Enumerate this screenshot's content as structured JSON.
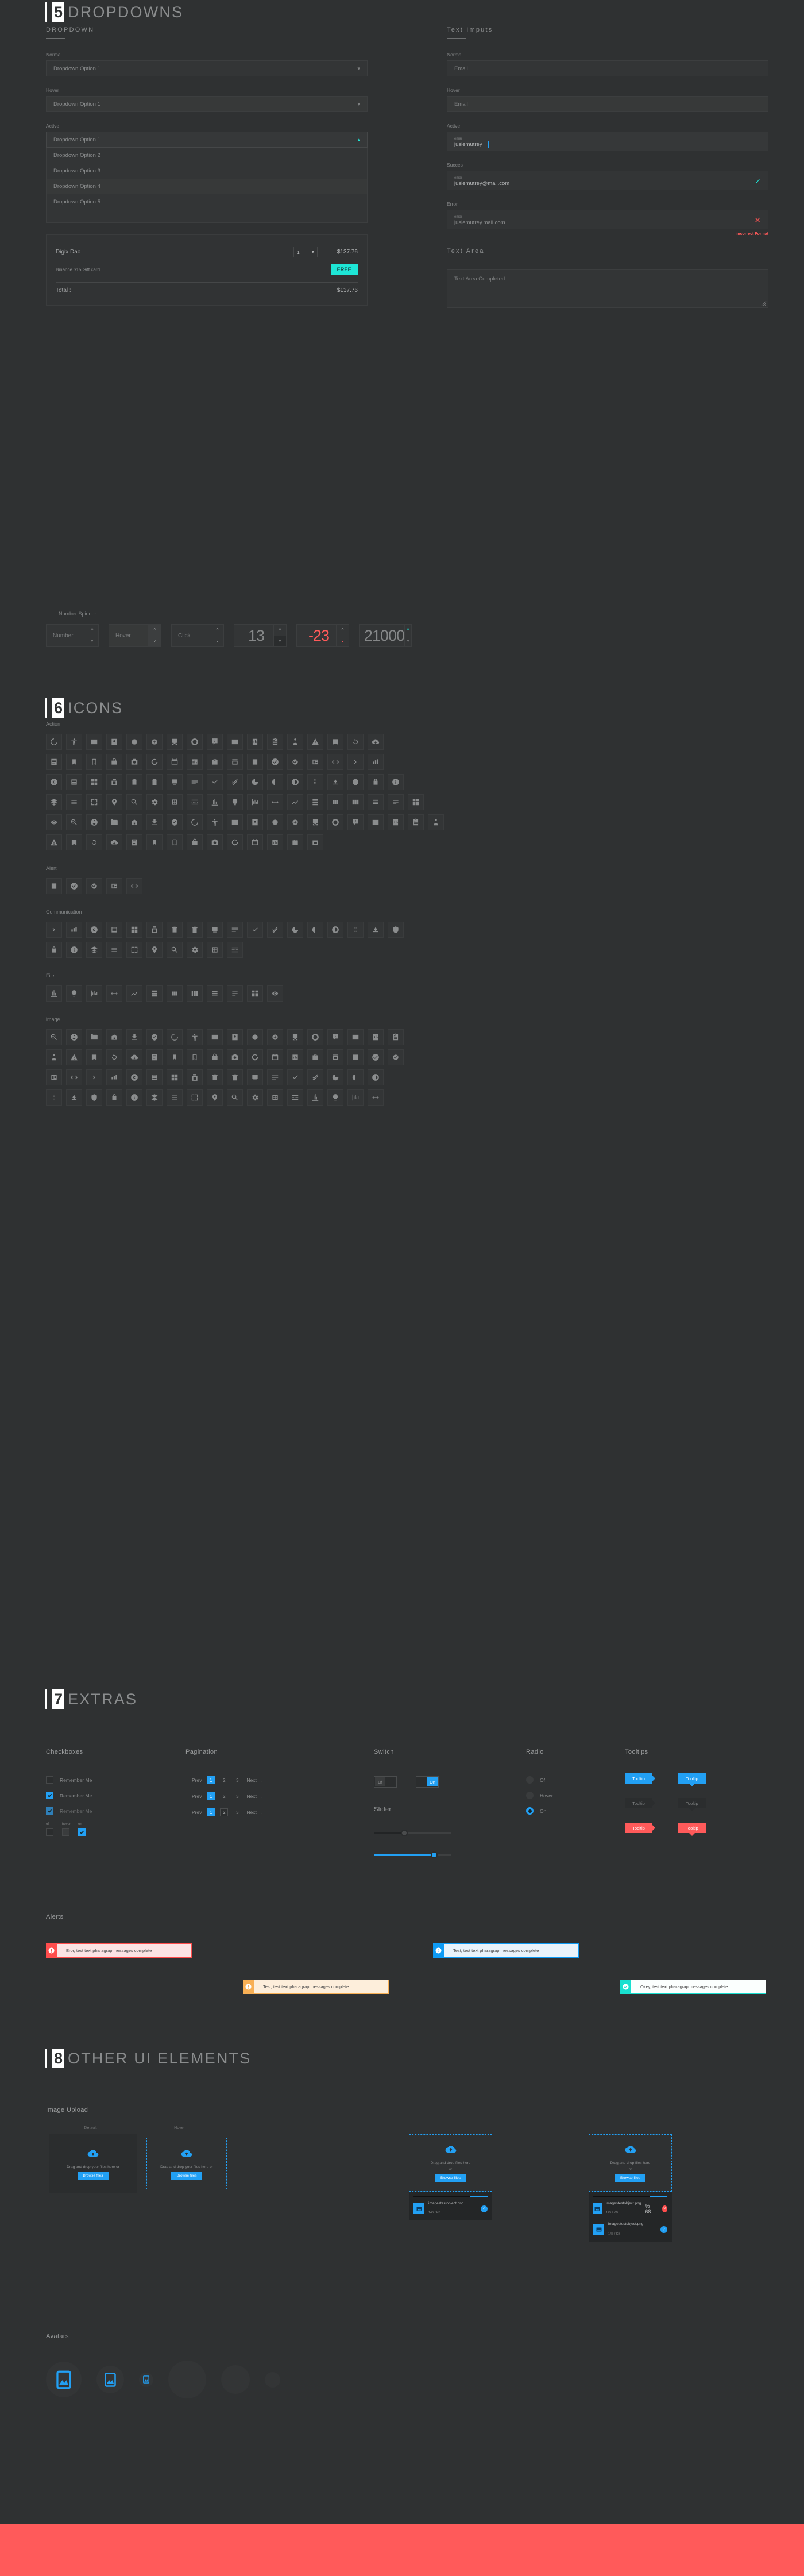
{
  "colors": {
    "bg": "#2f3132",
    "accent_blue": "#22a0f4",
    "accent_cyan": "#1ee6d6",
    "accent_red": "#ff5a5a",
    "bottom_bar": "#ff5a5a"
  },
  "sections": {
    "dropdowns": {
      "number": "5",
      "title": "DROPDOWNS",
      "left_sub": "DROPDOWN",
      "right_sub": "Text Imputs",
      "textarea_sub": "Text Area",
      "states": {
        "normal": "Normal",
        "hover": "Hover",
        "active": "Active",
        "success": "Succes",
        "error": "Error"
      },
      "dropdown_value": "Dropdown Option 1",
      "options": [
        "Dropdown Option 2",
        "Dropdown Option 3",
        "Dropdown Option 4",
        "Dropdown Option 5"
      ],
      "cart": {
        "item_name": "Digix Dao",
        "item_qty": "1",
        "item_price": "$137.76",
        "gift_name": "Binance $15 Gift card",
        "gift_badge": "FREE",
        "total_label": "Total :",
        "total_price": "$137.76"
      },
      "inputs": {
        "normal_placeholder": "Email",
        "hover_placeholder": "Email",
        "active_label": "email",
        "active_value": "jusiemutrey",
        "success_label": "email",
        "success_value": "jusiemutrey@mail.com",
        "error_label": "email",
        "error_value": "jusiemutrey.mail.com",
        "error_message": "incorrect Format"
      },
      "textarea_placeholder": "Text Area Completed",
      "spinner": {
        "title": "Number Spinner",
        "items": [
          {
            "value": "Number",
            "state": "normal"
          },
          {
            "value": "Hover",
            "state": "hover"
          },
          {
            "value": "Click",
            "state": "click"
          },
          {
            "value": "13",
            "state": "big"
          },
          {
            "value": "-23",
            "state": "error"
          },
          {
            "value": "21000",
            "state": "success"
          }
        ]
      }
    },
    "icons": {
      "number": "6",
      "title": "ICONS",
      "categories": [
        {
          "label": "Action",
          "rows": [
            [
              "3d-rotation-icon",
              "accessibility-icon",
              "account-balance-wallet-icon",
              "account-box-icon",
              "alarm-icon",
              "alarm-add-icon",
              "all-inbox-icon",
              "all-out-icon",
              "announcement-icon",
              "aspect-ratio-icon",
              "assessment-icon",
              "assignment-icon",
              "assignment-ind-icon",
              "assignment-late-icon",
              "assignment-turned-in-icon",
              "autorenew-icon",
              "backup-icon"
            ],
            [
              "book-icon",
              "bookmark-icon",
              "bookmark-border-icon",
              "bug-report-icon",
              "build-icon",
              "cached-icon",
              "calendar-today-icon",
              "card-membership-icon",
              "card-travel-icon",
              "chrome-reader-icon",
              "class-icon",
              "change-history-icon",
              "check-circle-icon",
              "check-circle-outline-icon",
              "chrome-reader-mode-icon",
              "code-icon",
              "compare-arrows-icon"
            ],
            [
              "trending-icon",
              "copyright-icon",
              "credit-card-icon",
              "dashboard-icon",
              "date-range-icon",
              "delete-icon",
              "delete-outline-icon",
              "description-icon",
              "dns-icon",
              "done-icon",
              "done-all-icon",
              "donut-large-icon",
              "donut-small-icon",
              "drag-indicator-icon",
              "eject-icon",
              "euro-icon",
              "event-icon",
              "exit-to-app-icon"
            ],
            [
              "explore-icon",
              "explore-off-icon",
              "extension-icon",
              "face-icon",
              "favorite-icon",
              "favorite-border-icon",
              "feedback-icon",
              "file-copy-icon",
              "find-in-page-icon",
              "fingerprint-icon",
              "flight-land-icon",
              "flight-takeoff-icon",
              "flip-to-back-icon",
              "get-app-icon",
              "grade-icon",
              "home-icon",
              "hourglass-icon",
              "https-icon",
              "info-icon"
            ],
            [
              "list-icon",
              "launch-icon",
              "language-icon",
              "label-icon",
              "lightbulb-icon",
              "line-style-icon",
              "list-alt-icon",
              "lock-icon",
              "lock-open-icon",
              "loyalty-icon",
              "place-icon",
              "search-icon",
              "settings-icon",
              "settings-applications-icon",
              "settings-input-icon",
              "settings-overscan-icon",
              "shop-icon",
              "thumb-down-icon",
              "thumb-up-icon",
              "timeline-icon"
            ],
            [
              "arrow-right-icon",
              "trending-up-icon",
              "view-agenda-icon",
              "view-array-icon",
              "view-carousel-icon",
              "view-column-icon",
              "view-day-icon",
              "view-headline-icon",
              "view-list-icon",
              "view-module-icon",
              "view-quilt-icon",
              "visibility-icon",
              "zoom-in-icon",
              "zoom-out-icon"
            ]
          ]
        },
        {
          "label": "Alert",
          "rows": [
            [
              "add-alert-icon",
              "error-icon",
              "error-outline-icon",
              "notification-important-icon",
              "warning-icon"
            ]
          ]
        },
        {
          "label": "Communication",
          "rows": [
            [
              "alternate-email-icon",
              "business-icon",
              "call-icon",
              "call-made-icon",
              "call-merge-icon",
              "call-missed-icon",
              "call-missed-outgoing-icon",
              "call-received-icon",
              "call-split-icon",
              "cancel-presentation-icon",
              "chat-icon",
              "chat-bubble-icon",
              "comment-icon",
              "contact-mail-icon",
              "contact-phone-icon",
              "contacts-icon",
              "dialer-sip-icon",
              "dialpad-icon"
            ],
            [
              "do-not-disturb-icon",
              "email-icon",
              "forum-icon",
              "location-on-icon",
              "message-icon",
              "import-contacts-icon",
              "live-help-icon",
              "rss-feed-icon",
              "ring-volume-icon",
              "vpn-key-icon"
            ]
          ]
        },
        {
          "label": "File",
          "rows": [
            [
              "attachment-icon",
              "cloud-icon",
              "cloud-circle-icon",
              "cloud-done-icon",
              "cloud-download-icon",
              "cloud-off-icon",
              "cloud-queue-icon",
              "cloud-upload-icon",
              "create-new-folder-icon",
              "folder-icon",
              "folder-open-icon",
              "folder-shared-icon"
            ]
          ]
        },
        {
          "label": "image",
          "rows": [
            [
              "add-a-photo-icon",
              "add-to-photos-icon",
              "adjust-icon",
              "assistant-icon",
              "audiotrack-icon",
              "flag-icon",
              "blur-circular-icon",
              "blur-linear-icon",
              "blur-off-icon",
              "brightness-icon",
              "brush-icon",
              "burst-mode-icon",
              "camera-icon",
              "camera-alt-icon",
              "camera-front-icon",
              "camera-rear-icon",
              "collections-icon",
              "color-lens-icon"
            ],
            [
              "compare-icon",
              "control-point-icon",
              "crop-icon",
              "crop-free-icon",
              "edit-icon",
              "exposure-icon",
              "filter-icon",
              "filter-frames-icon",
              "flare-icon",
              "flip-icon",
              "gradient-icon",
              "grain-icon",
              "grid-on-icon",
              "hdr-on-icon",
              "healing-icon",
              "image-icon",
              "image-aspect-icon",
              "iso-icon"
            ],
            [
              "cloud-icon",
              "landscape-icon",
              "leak-add-icon",
              "lens-icon",
              "linked-camera-icon",
              "looks-icon",
              "loupe-icon",
              "monochrome-photos-icon",
              "movie-creation-icon",
              "nature-icon",
              "navigate-before-icon",
              "palette-icon",
              "panorama-icon",
              "photo-album-icon",
              "photo-filter-icon",
              "picture-in-picture-icon",
              "portrait-icon"
            ],
            [
              "remove-red-eye-icon",
              "rotate-left-icon",
              "rotate-right-icon",
              "slideshow-icon",
              "straighten-icon",
              "style-icon",
              "switch-camera-icon",
              "tag-faces-icon",
              "texture-icon",
              "timelapse-icon",
              "timer-icon",
              "tonality-icon",
              "transform-icon",
              "tune-icon",
              "view-comfy-icon",
              "vignette-icon",
              "wb-sunny-icon"
            ]
          ]
        }
      ]
    },
    "extras": {
      "number": "7",
      "title": "EXTRAS",
      "checkboxes": {
        "title": "Checkboxes",
        "items": [
          {
            "label": "Remember Me",
            "state": "off"
          },
          {
            "label": "Remember Me",
            "state": "on"
          },
          {
            "label": "Remember Me",
            "state": "disabled"
          }
        ],
        "states_row": [
          "of",
          "hover",
          "on"
        ]
      },
      "pagination": {
        "title": "Pagination",
        "prev": "← Prev",
        "next": "Next →",
        "pages": [
          "1",
          "2",
          "3"
        ],
        "rows": [
          {
            "active": "1",
            "hover": ""
          },
          {
            "active": "1",
            "hover": ""
          },
          {
            "active": "1",
            "hover": "2"
          }
        ]
      },
      "switch": {
        "title": "Switch",
        "off_label": "Of",
        "on_label": "On"
      },
      "slider": {
        "title": "Slider"
      },
      "radio": {
        "title": "Radio",
        "items": [
          {
            "label": "Of",
            "state": "off"
          },
          {
            "label": "Hover",
            "state": "hover"
          },
          {
            "label": "On",
            "state": "on"
          }
        ]
      },
      "tooltips": {
        "title": "Tooltips",
        "label": "Tooltip"
      },
      "alerts": {
        "title": "Alerts",
        "items": [
          {
            "kind": "err",
            "icon": "error-icon",
            "text": "Eror, test text pharagrap messages complete"
          },
          {
            "kind": "info",
            "icon": "help-icon",
            "text": "Test,  test text pharagrap messages complete"
          },
          {
            "kind": "warn",
            "icon": "warning-icon",
            "text": "Test,  test text pharagrap messages complete"
          },
          {
            "kind": "ok",
            "icon": "check-icon",
            "text": "Okey, test text pharagrap messages complete"
          }
        ]
      }
    },
    "other": {
      "number": "8",
      "title": "OTHER UI ELEMENTS",
      "image_upload": {
        "title": "Image Upload",
        "state_labels": [
          "Default",
          "Hover"
        ],
        "cards": [
          {
            "drag_text": "Drag and drop your files here or",
            "button": "Browse files",
            "variant": "framed"
          },
          {
            "drag_text": "Drag and drop your files here or",
            "button": "Browse files",
            "variant": "plain"
          },
          {
            "drag_text": "Drag and drop files here",
            "or": "or",
            "button": "Browse files",
            "variant": "plain"
          },
          {
            "drag_text": "Drag and drop files here",
            "or": "or",
            "button": "Browse files",
            "variant": "plain"
          }
        ],
        "file_panels": [
          {
            "progress": 75,
            "files": [
              {
                "name": "imagestestobject.png",
                "size": "145 / KB",
                "status": "ok"
              }
            ]
          },
          {
            "progress": 68,
            "percent_label": "% 68",
            "files": [
              {
                "name": "imagestestobject.png",
                "size": "145 / KB",
                "status": "x"
              },
              {
                "name": "imagestestobject.png",
                "size": "145 / KB",
                "status": "ok"
              }
            ]
          }
        ]
      },
      "avatars": {
        "title": "Avatars",
        "items": [
          {
            "size": 62,
            "icon": true
          },
          {
            "size": 48,
            "icon": true
          },
          {
            "size": 25,
            "icon": true
          },
          {
            "size": 66,
            "icon": false
          },
          {
            "size": 50,
            "icon": false
          },
          {
            "size": 27,
            "icon": false
          }
        ]
      }
    }
  }
}
